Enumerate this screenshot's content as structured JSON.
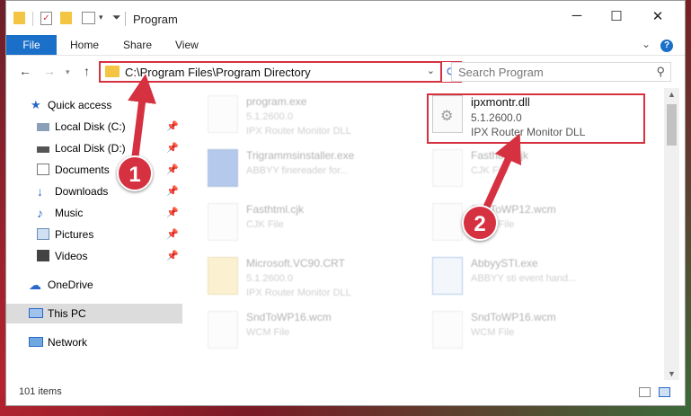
{
  "window": {
    "title": "Program"
  },
  "ribbon": {
    "tabs": [
      "File",
      "Home",
      "Share",
      "View"
    ],
    "help": "?"
  },
  "address": {
    "path": "C:\\Program Files\\Program Directory"
  },
  "search": {
    "placeholder": "Search Program"
  },
  "sidebar": {
    "items": [
      {
        "label": "Quick access",
        "icon": "star-icon",
        "pinned": false
      },
      {
        "label": "Local Disk (C:)",
        "icon": "drive-icon",
        "pinned": true
      },
      {
        "label": "Local Disk (D:)",
        "icon": "drive-icon",
        "pinned": true
      },
      {
        "label": "Documents",
        "icon": "documents-icon",
        "pinned": true
      },
      {
        "label": "Downloads",
        "icon": "download-arrow-icon",
        "pinned": true
      },
      {
        "label": "Music",
        "icon": "music-note-icon",
        "pinned": true
      },
      {
        "label": "Pictures",
        "icon": "pictures-icon",
        "pinned": true
      },
      {
        "label": "Videos",
        "icon": "film-icon",
        "pinned": true
      },
      {
        "label": "OneDrive",
        "icon": "cloud-icon",
        "pinned": false
      },
      {
        "label": "This PC",
        "icon": "monitor-icon",
        "pinned": false,
        "selected": true
      },
      {
        "label": "Network",
        "icon": "network-icon",
        "pinned": false
      }
    ]
  },
  "files": [
    {
      "name": "program.exe",
      "line2": "5.1.2600.0",
      "line3": "IPX Router Monitor DLL",
      "faded": true
    },
    {
      "name": "ipxmontr.dll",
      "line2": "5.1.2600.0",
      "line3": "IPX Router Monitor DLL",
      "faded": false
    },
    {
      "name": "Trigrammsinstaller.exe",
      "line2": "ABBYY finereader for...",
      "line3": "",
      "faded": true
    },
    {
      "name": "Fasthtml.cjk",
      "line2": "CJK File",
      "line3": "",
      "faded": true
    },
    {
      "name": "Fasthtml.cjk",
      "line2": "CJK File",
      "line3": "",
      "faded": true
    },
    {
      "name": "SndToWP12.wcm",
      "line2": "WCM File",
      "line3": "",
      "faded": true
    },
    {
      "name": "Microsoft.VC90.CRT",
      "line2": "5.1.2600.0",
      "line3": "IPX Router Monitor DLL",
      "faded": true
    },
    {
      "name": "AbbyySTI.exe",
      "line2": "ABBYY sti event hand...",
      "line3": "",
      "faded": true
    },
    {
      "name": "SndToWP16.wcm",
      "line2": "WCM File",
      "line3": "",
      "faded": true
    },
    {
      "name": "SndToWP16.wcm",
      "line2": "WCM File",
      "line3": "",
      "faded": true
    }
  ],
  "status": {
    "count": "101 items"
  },
  "annotations": {
    "badge1": "1",
    "badge2": "2",
    "color": "#d63140"
  },
  "colors": {
    "accent": "#1a6fc9",
    "highlight": "#d63140"
  }
}
